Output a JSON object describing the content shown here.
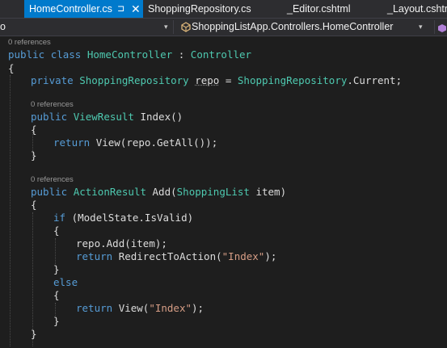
{
  "tabs": [
    {
      "label": "HomeController.cs",
      "active": true
    },
    {
      "label": "ShoppingRepository.cs",
      "active": false
    },
    {
      "label": "_Editor.cshtml",
      "active": false
    },
    {
      "label": "_Layout.cshtml",
      "active": false
    }
  ],
  "tab_pin_glyph": "⊐",
  "tab_close_glyph": "✕",
  "navbar": {
    "project_fragment": "o",
    "type_scope": "ShoppingListApp.Controllers.HomeController",
    "dropdown_glyph": "▾"
  },
  "lens": {
    "class_refs": "0 references",
    "index_refs": "0 references",
    "add_refs": "0 references"
  },
  "code": {
    "l_class": [
      "public",
      " ",
      "class",
      " ",
      "HomeController",
      " : ",
      "Controller"
    ],
    "l_open1": "{",
    "l_field": [
      "private",
      " ",
      "ShoppingRepository",
      " ",
      "repo",
      " = ",
      "ShoppingRepository",
      ".",
      "Current",
      ";"
    ],
    "l_index": [
      "public",
      " ",
      "ViewResult",
      " ",
      "Index",
      "()"
    ],
    "l_open2": "{",
    "l_return1": [
      "return",
      " ",
      "View",
      "(",
      "repo",
      ".",
      "GetAll",
      "());"
    ],
    "l_close2": "}",
    "l_add": [
      "public",
      " ",
      "ActionResult",
      " ",
      "Add",
      "(",
      "ShoppingList",
      " ",
      "item",
      ")"
    ],
    "l_open3": "{",
    "l_if": [
      "if",
      " (",
      "ModelState",
      ".",
      "IsValid",
      ")"
    ],
    "l_open4": "{",
    "l_repoadd": [
      "repo",
      ".",
      "Add",
      "(",
      "item",
      ");"
    ],
    "l_return2": [
      "return",
      " ",
      "RedirectToAction",
      "(",
      "\"Index\"",
      ");"
    ],
    "l_close4": "}",
    "l_else": "else",
    "l_open5": "{",
    "l_return3": [
      "return",
      " ",
      "View",
      "(",
      "\"Index\"",
      ");"
    ],
    "l_close5": "}",
    "l_close3": "}"
  },
  "colors": {
    "background": "#1e1e1e",
    "keyword": "#569cd6",
    "type": "#4ec9b0",
    "method": "#dcdcaa",
    "string": "#d69d85",
    "text": "#dcdcdc",
    "active_tab": "#007acc"
  }
}
